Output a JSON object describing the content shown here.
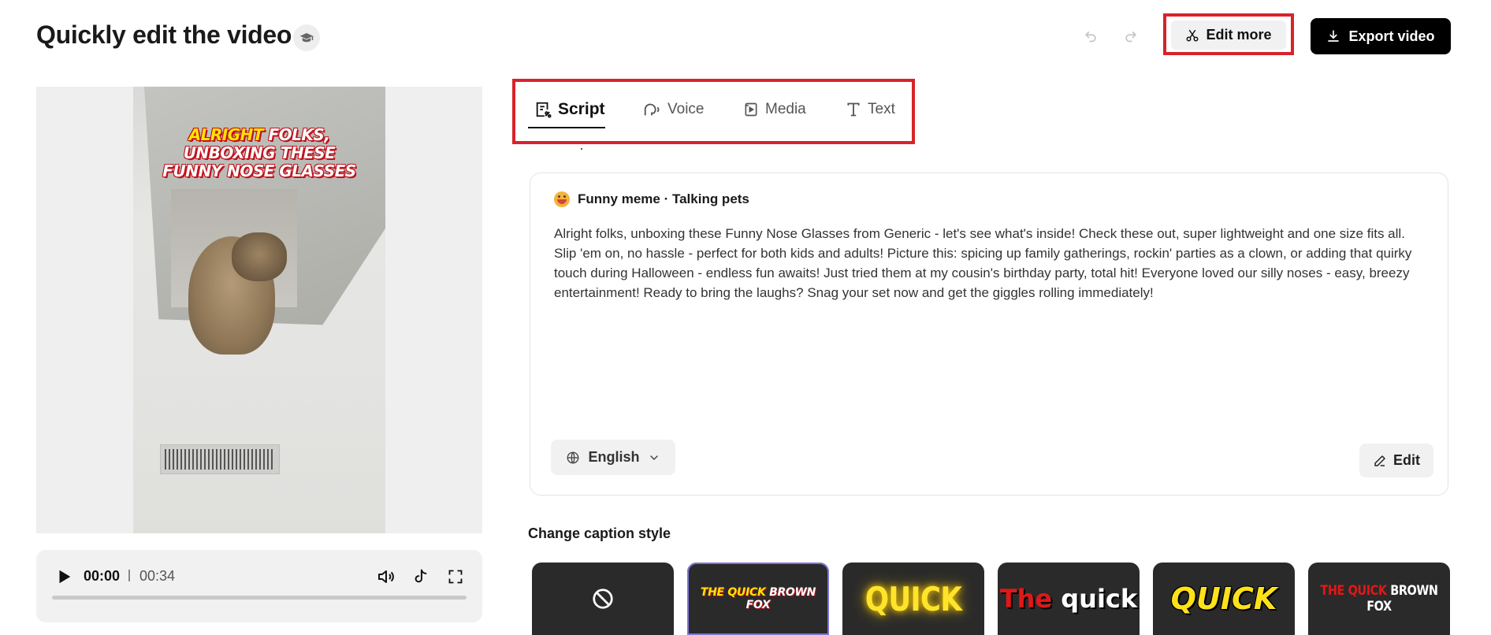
{
  "header": {
    "title": "Quickly edit the video",
    "edit_more_label": "Edit more",
    "export_label": "Export video"
  },
  "video": {
    "caption_highlight": "ALRIGHT",
    "caption_line1_rest": " FOLKS,",
    "caption_line2": "UNBOXING THESE",
    "caption_line3": "FUNNY NOSE GLASSES"
  },
  "player": {
    "current_time": "00:00",
    "total_time": "00:34",
    "progress": 0
  },
  "tabs": [
    {
      "label": "Script",
      "active": true
    },
    {
      "label": "Voice",
      "active": false
    },
    {
      "label": "Media",
      "active": false
    },
    {
      "label": "Text",
      "active": false
    }
  ],
  "script_card": {
    "tag": "Funny meme · Talking pets",
    "text": "Alright folks, unboxing these Funny Nose Glasses from Generic - let's see what's inside! Check these out, super lightweight and one size fits all. Slip 'em on, no hassle - perfect for both kids and adults! Picture this: spicing up family gatherings, rockin' parties as a clown, or adding that quirky touch during Halloween - endless fun awaits! Just tried them at my cousin's birthday party, total hit! Everyone loved our silly noses - easy, breezy entertainment! Ready to bring the laughs? Snag your set now and get the giggles rolling immediately!",
    "language": "English",
    "edit_label": "Edit"
  },
  "caption_style": {
    "heading": "Change caption style",
    "styles": [
      {
        "id": "none"
      },
      {
        "id": "fox-small",
        "text_hl": "THE QUICK",
        "text_rest": " BROWN FOX",
        "selected": true
      },
      {
        "id": "quick-yellow",
        "text": "QUICK"
      },
      {
        "id": "the-quick",
        "text_red": "The",
        "text_rest": " quick"
      },
      {
        "id": "quick-italic",
        "text": "QUICK"
      },
      {
        "id": "fox-red",
        "text_red": "THE QUICK",
        "text_rest": " BROWN FOX"
      }
    ]
  },
  "colors": {
    "highlight_border": "#d8232a",
    "export_bg": "#000000",
    "selected_style_outline": "#7b74d6"
  }
}
